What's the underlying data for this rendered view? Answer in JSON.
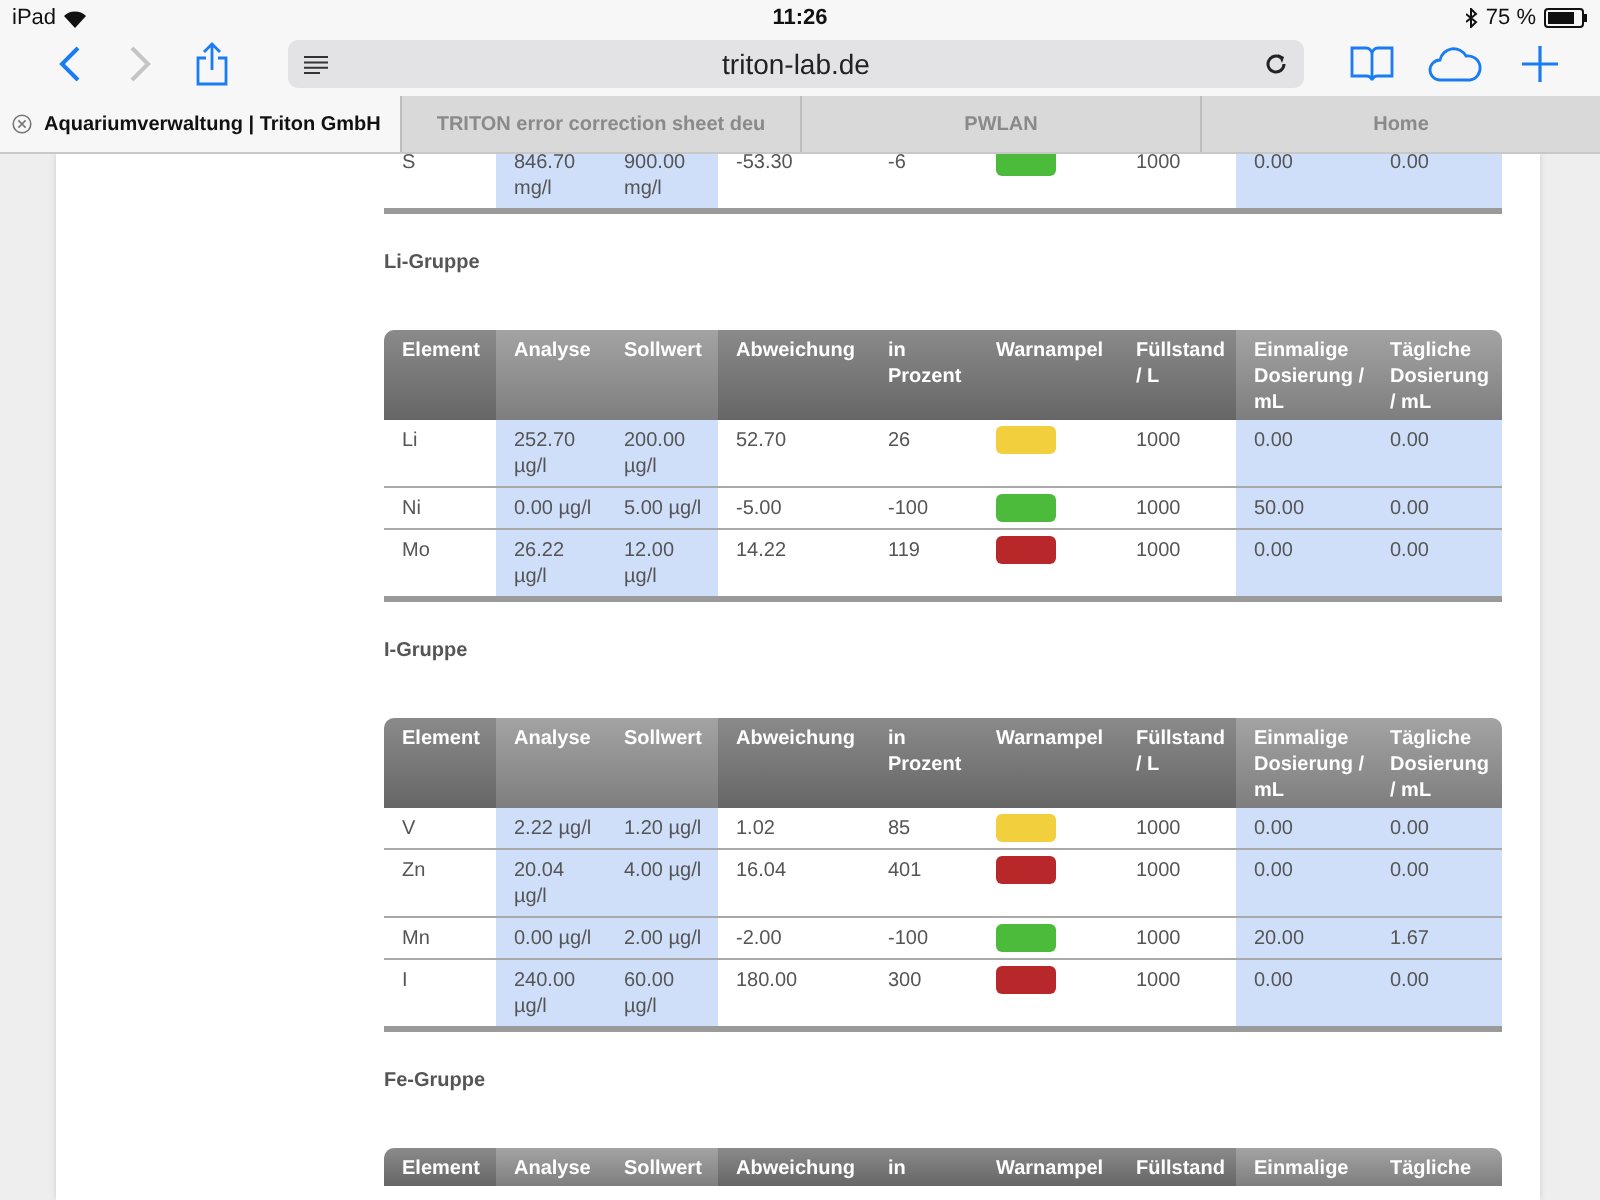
{
  "status_bar": {
    "device": "iPad",
    "time": "11:26",
    "battery": "75 %"
  },
  "toolbar": {
    "back": {
      "disabled": false
    },
    "forward": {
      "disabled": true
    },
    "address": "triton-lab.de"
  },
  "tabs": [
    {
      "label": "Aquariumverwaltung | Triton GmbH",
      "selected": true
    },
    {
      "label": "TRITON error correction sheet deu",
      "selected": false
    },
    {
      "label": "PWLAN",
      "selected": false
    },
    {
      "label": "Home",
      "selected": false
    }
  ],
  "sections": [
    {
      "rows": [
        {
          "cells": [
            "S",
            "846.70 mg/l",
            "900.00 mg/l",
            "-53.30",
            "-6",
            "1000",
            "0.00",
            "0.00"
          ],
          "color": "#4cbb3b"
        }
      ]
    },
    {
      "title": "Li-Gruppe",
      "headers": [
        "Element",
        "Analyse",
        "Sollwert",
        "Abweichung",
        "in Prozent",
        "Warnampel",
        "Füllstand / L",
        "Einmalige Dosierung / mL",
        "Tägliche Dosierung / mL"
      ],
      "rows": [
        {
          "cells": [
            "Li",
            "252.70 µg/l",
            "200.00 µg/l",
            "52.70",
            "26",
            "1000",
            "0.00",
            "0.00"
          ],
          "color": "#f2cf3c"
        },
        {
          "cells": [
            "Ni",
            "0.00 µg/l",
            "5.00 µg/l",
            "-5.00",
            "-100",
            "1000",
            "50.00",
            "0.00"
          ],
          "color": "#4cbb3b"
        },
        {
          "cells": [
            "Mo",
            "26.22 µg/l",
            "12.00 µg/l",
            "14.22",
            "119",
            "1000",
            "0.00",
            "0.00"
          ],
          "color": "#b8282b"
        }
      ]
    },
    {
      "title": "I-Gruppe",
      "headers": [
        "Element",
        "Analyse",
        "Sollwert",
        "Abweichung",
        "in Prozent",
        "Warnampel",
        "Füllstand / L",
        "Einmalige Dosierung / mL",
        "Tägliche Dosierung / mL"
      ],
      "rows": [
        {
          "cells": [
            "V",
            "2.22 µg/l",
            "1.20 µg/l",
            "1.02",
            "85",
            "1000",
            "0.00",
            "0.00"
          ],
          "color": "#f2cf3c"
        },
        {
          "cells": [
            "Zn",
            "20.04 µg/l",
            "4.00 µg/l",
            "16.04",
            "401",
            "1000",
            "0.00",
            "0.00"
          ],
          "color": "#b8282b"
        },
        {
          "cells": [
            "Mn",
            "0.00 µg/l",
            "2.00 µg/l",
            "-2.00",
            "-100",
            "1000",
            "20.00",
            "1.67"
          ],
          "color": "#4cbb3b"
        },
        {
          "cells": [
            "I",
            "240.00 µg/l",
            "60.00 µg/l",
            "180.00",
            "300",
            "1000",
            "0.00",
            "0.00"
          ],
          "color": "#b8282b"
        }
      ]
    },
    {
      "title": "Fe-Gruppe",
      "headers": [
        "Element",
        "Analyse",
        "Sollwert",
        "Abweichung",
        "in",
        "Warnampel",
        "Füllstand",
        "Einmalige",
        "Tägliche"
      ]
    }
  ]
}
